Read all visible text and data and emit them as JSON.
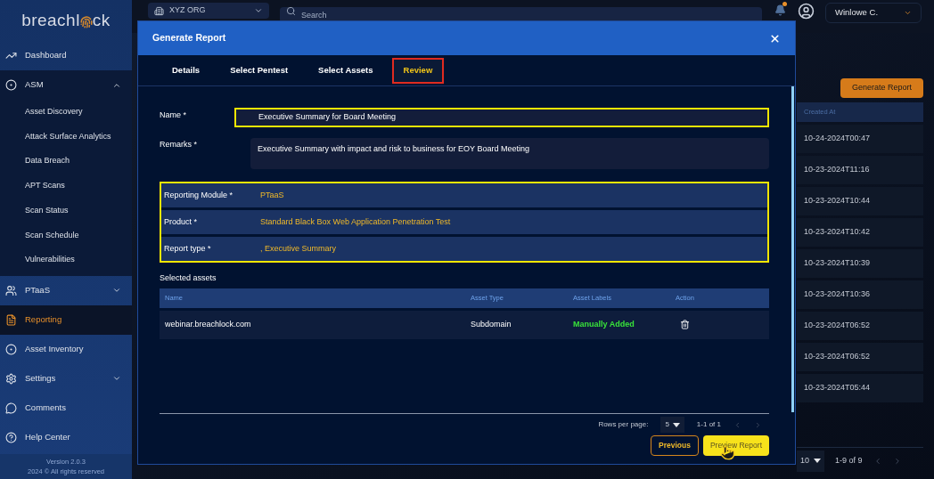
{
  "logo": {
    "before": "breachl",
    "after": "ck"
  },
  "sidebar": {
    "items": [
      {
        "label": "Dashboard",
        "selected": false
      },
      {
        "label": "ASM",
        "selected": false,
        "expanded": true,
        "children": [
          {
            "label": "Asset Discovery"
          },
          {
            "label": "Attack Surface Analytics"
          },
          {
            "label": "Data Breach"
          },
          {
            "label": "APT Scans"
          },
          {
            "label": "Scan Status"
          },
          {
            "label": "Scan Schedule"
          },
          {
            "label": "Vulnerabilities"
          }
        ]
      },
      {
        "label": "PTaaS",
        "selected": false,
        "expanded": false
      },
      {
        "label": "Reporting",
        "selected": true
      },
      {
        "label": "Asset Inventory",
        "selected": false
      },
      {
        "label": "Settings",
        "selected": false,
        "expanded": false
      },
      {
        "label": "Comments",
        "selected": false
      },
      {
        "label": "Help Center",
        "selected": false
      }
    ],
    "version": "Version 2.0.3",
    "copyright": "2024 © All rights reserved"
  },
  "header": {
    "org": "XYZ ORG",
    "search": {
      "placeholder": "Search"
    },
    "notification": true,
    "user": "Winlowe C."
  },
  "page": {
    "button": "Generate Report",
    "column": "Created At",
    "rows": [
      "10-24-2024T00:47",
      "10-23-2024T11:16",
      "10-23-2024T10:44",
      "10-23-2024T10:42",
      "10-23-2024T10:39",
      "10-23-2024T10:36",
      "10-23-2024T06:52",
      "10-23-2024T06:52",
      "10-23-2024T05:44"
    ],
    "rows_per_page": "10",
    "range": "1-9 of 9"
  },
  "dialog": {
    "title": "Generate Report",
    "tabs": [
      {
        "label": "Details",
        "selected": false,
        "highlighted": false
      },
      {
        "label": "Select Pentest",
        "selected": false,
        "highlighted": false
      },
      {
        "label": "Select Assets",
        "selected": false,
        "highlighted": false
      },
      {
        "label": "Review",
        "selected": true,
        "highlighted": true
      }
    ],
    "name": {
      "label": "Name *",
      "value": "Executive Summary for Board Meeting",
      "highlighted": true
    },
    "remarks": {
      "label": "Remarks *",
      "value": "Executive Summary with impact and risk to business for EOY Board Meeting"
    },
    "summary": {
      "highlighted": true,
      "rows": [
        {
          "label": "Reporting Module *",
          "value": "PTaaS"
        },
        {
          "label": "Product *",
          "value": "Standard Black Box Web Application Penetration Test"
        },
        {
          "label": "Report type *",
          "value": ", Executive Summary"
        }
      ]
    },
    "assets_title": "Selected assets",
    "table": {
      "columns": [
        "Name",
        "Asset Type",
        "Asset Labels",
        "Action"
      ],
      "rows": [
        {
          "name": "webinar.breachlock.com",
          "type": "Subdomain",
          "label": "Manually Added"
        }
      ]
    },
    "pagination": {
      "label": "Rows per page:",
      "rows_per_page": "5",
      "range": "1-1 of 1"
    },
    "buttons": [
      {
        "label": "Previous",
        "kind": "outline"
      },
      {
        "label": "Preview Report",
        "kind": "primary"
      }
    ]
  }
}
